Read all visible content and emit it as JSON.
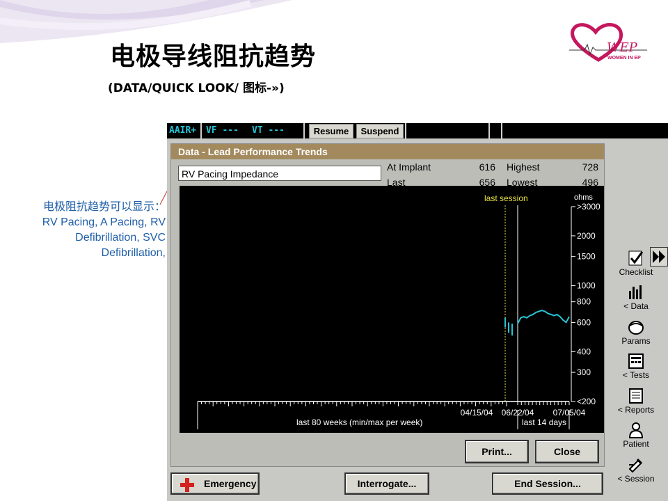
{
  "slide": {
    "title": "电极导线阻抗趋势",
    "subtitle": "(DATA/QUICK LOOK/ 图标-»)",
    "logo_text": "WOMEN IN EP",
    "annotation": [
      "电极阻抗趋势可以显示：",
      "RV Pacing, A Pacing, RV",
      "Defibrillation, SVC",
      "Defibrillation,"
    ]
  },
  "device": {
    "top_bar": {
      "mode": "AAIR+",
      "vf": "VF ---",
      "vt": "VT ---",
      "resume_label": "Resume",
      "suspend_label": "Suspend"
    },
    "panel": {
      "title": "Data - Lead Performance Trends",
      "selected_lead": "RV Pacing Impedance",
      "stats": {
        "at_implant_label": "At Implant",
        "at_implant_value": "616",
        "last_label": "Last",
        "last_value": "656",
        "highest_label": "Highest",
        "highest_value": "728",
        "lowest_label": "Lowest",
        "lowest_value": "496"
      },
      "print_label": "Print...",
      "close_label": "Close"
    },
    "bottom_buttons": {
      "emergency_label": "Emergency",
      "interrogate_label": "Interrogate...",
      "end_session_label": "End Session..."
    },
    "sidebar": [
      {
        "label": "Checklist",
        "icon": "checklist-icon"
      },
      {
        "label": "< Data",
        "icon": "data-icon"
      },
      {
        "label": "Params",
        "icon": "params-icon"
      },
      {
        "label": "< Tests",
        "icon": "tests-icon"
      },
      {
        "label": "< Reports",
        "icon": "reports-icon"
      },
      {
        "label": "Patient",
        "icon": "patient-icon"
      },
      {
        "label": "< Session",
        "icon": "session-icon"
      }
    ]
  },
  "chart_data": {
    "type": "line",
    "ylabel": "ohms",
    "yscale": "log",
    "yticks": [
      ">3000",
      "2000",
      "1500",
      "1000",
      "800",
      "600",
      "400",
      "300",
      "<200"
    ],
    "x_tick_labels": [
      "04/15/04",
      "06/22/04",
      "07/05/04"
    ],
    "x_caption_left": "last 80 weeks (min/max per week)",
    "x_caption_right": "last 14 days",
    "marker_label": "last session",
    "series_color": "#27c3d6",
    "marker_color": "#e8e040",
    "weekly_minmax": [
      [
        560,
        640
      ],
      [
        520,
        600
      ],
      [
        500,
        590
      ]
    ],
    "daily_values": [
      590,
      640,
      650,
      640,
      660,
      670,
      690,
      700,
      710,
      700,
      680,
      670,
      660,
      670,
      650,
      620,
      600,
      650
    ]
  }
}
